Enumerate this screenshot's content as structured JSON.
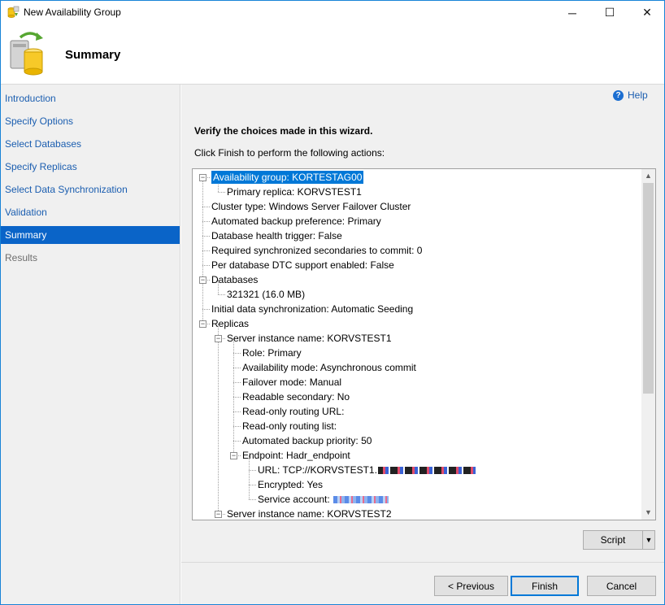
{
  "window": {
    "title": "New Availability Group",
    "controls": {
      "minimize": "─",
      "maximize": "☐",
      "close": "✕"
    }
  },
  "header": {
    "title": "Summary",
    "icon": "availability-group-wizard-icon"
  },
  "nav": {
    "items": [
      {
        "label": "Introduction",
        "state": "link"
      },
      {
        "label": "Specify Options",
        "state": "link"
      },
      {
        "label": "Select Databases",
        "state": "link"
      },
      {
        "label": "Specify Replicas",
        "state": "link"
      },
      {
        "label": "Select Data Synchronization",
        "state": "link"
      },
      {
        "label": "Validation",
        "state": "link"
      },
      {
        "label": "Summary",
        "state": "selected"
      },
      {
        "label": "Results",
        "state": "disabled"
      }
    ]
  },
  "main": {
    "help_label": "Help",
    "help_glyph": "?",
    "verify_text": "Verify the choices made in this wizard.",
    "instruction_text": "Click Finish to perform the following actions:",
    "tree": [
      {
        "text": "Availability group: KORTESTAG00",
        "level": 0,
        "expander": "minus",
        "selected": true
      },
      {
        "text": "Primary replica: KORVSTEST1",
        "level": 1
      },
      {
        "text": "Cluster type: Windows Server Failover Cluster",
        "level": 0
      },
      {
        "text": "Automated backup preference: Primary",
        "level": 0
      },
      {
        "text": "Database health trigger: False",
        "level": 0
      },
      {
        "text": "Required synchronized secondaries to commit: 0",
        "level": 0
      },
      {
        "text": "Per database DTC support enabled: False",
        "level": 0
      },
      {
        "text": "Databases",
        "level": 0,
        "expander": "minus"
      },
      {
        "text": "321321 (16.0 MB)",
        "level": 1
      },
      {
        "text": "Initial data synchronization: Automatic Seeding",
        "level": 0
      },
      {
        "text": "Replicas",
        "level": 0,
        "expander": "minus"
      },
      {
        "text": "Server instance name: KORVSTEST1",
        "level": 1,
        "expander": "minus"
      },
      {
        "text": "Role: Primary",
        "level": 2
      },
      {
        "text": "Availability mode: Asynchronous commit",
        "level": 2
      },
      {
        "text": "Failover mode: Manual",
        "level": 2
      },
      {
        "text": "Readable secondary: No",
        "level": 2
      },
      {
        "text": "Read-only routing URL:",
        "level": 2
      },
      {
        "text": "Read-only routing list:",
        "level": 2
      },
      {
        "text": "Automated backup priority: 50",
        "level": 2
      },
      {
        "text": "Endpoint: Hadr_endpoint",
        "level": 2,
        "expander": "minus"
      },
      {
        "text": "URL: TCP://KORVSTEST1.",
        "level": 3,
        "redacted": "dark"
      },
      {
        "text": "Encrypted: Yes",
        "level": 3
      },
      {
        "text": "Service account: ",
        "level": 3,
        "redacted": "blue"
      },
      {
        "text": "Server instance name: KORVSTEST2",
        "level": 1,
        "expander": "minus"
      }
    ],
    "script_label": "Script",
    "script_dropdown": "▼"
  },
  "footer": {
    "previous_label": "< Previous",
    "finish_label": "Finish",
    "cancel_label": "Cancel"
  },
  "scroll": {
    "up": "▲",
    "down": "▼"
  }
}
